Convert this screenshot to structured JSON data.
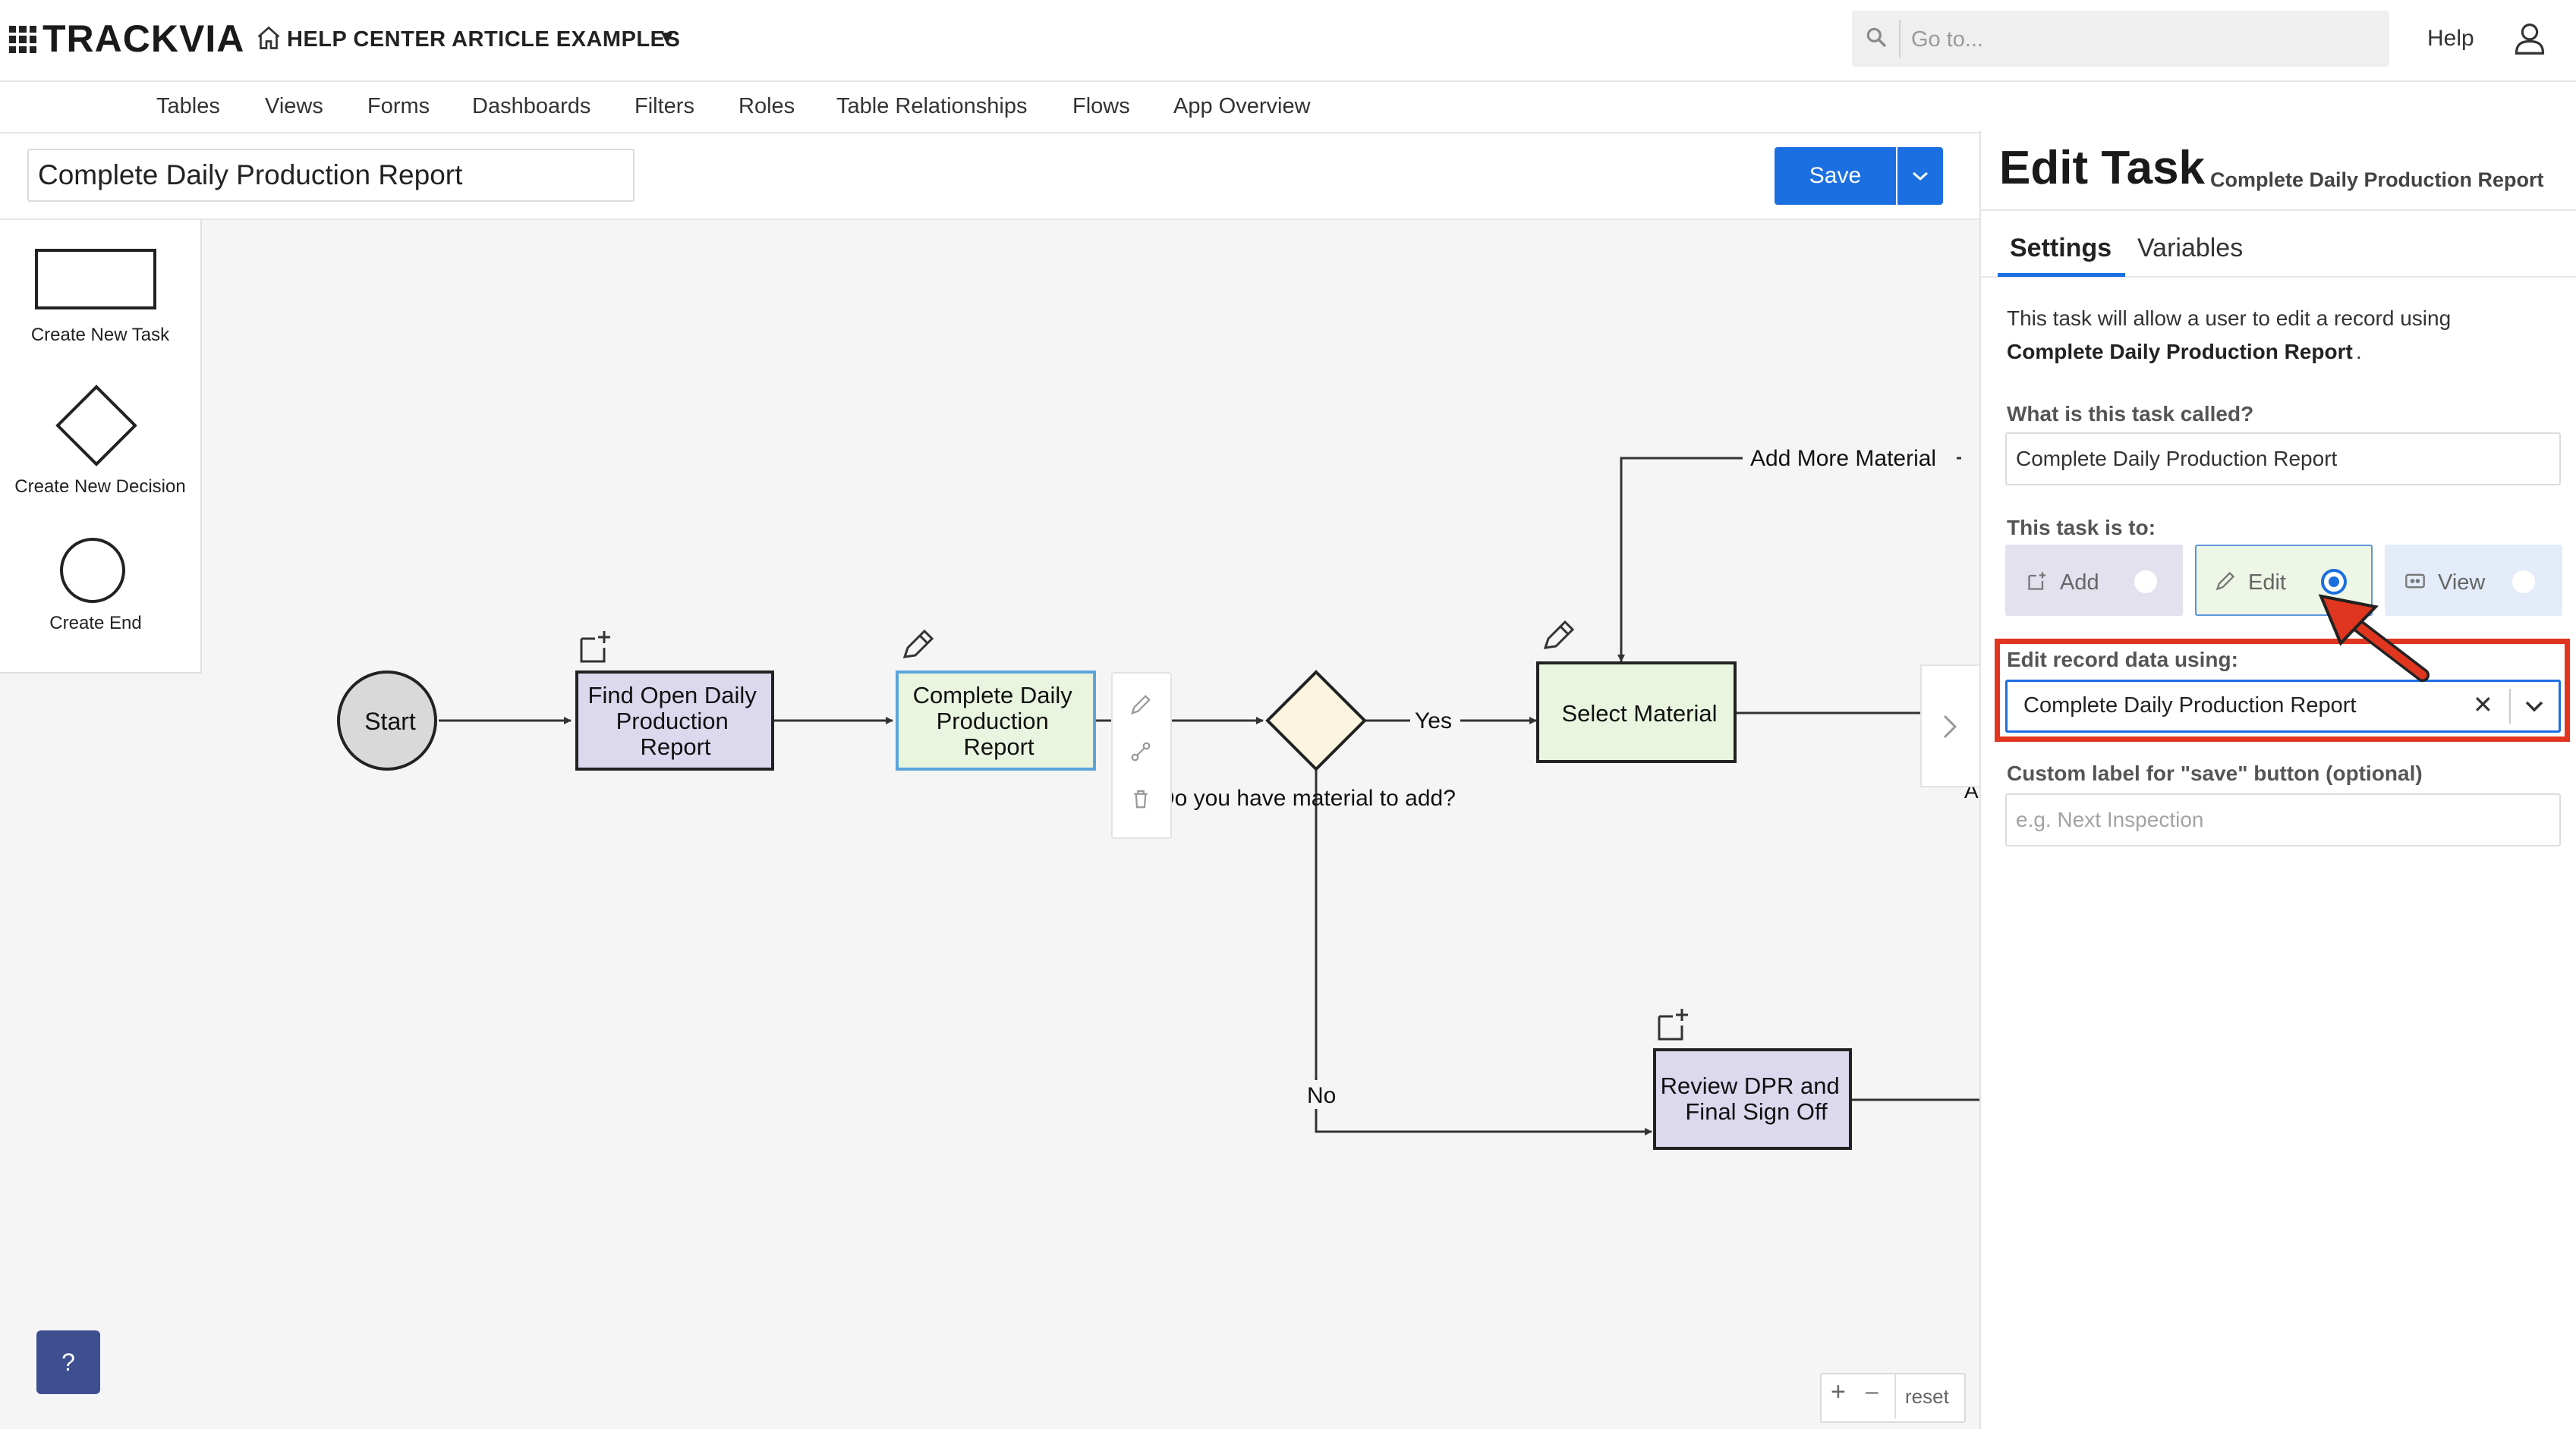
{
  "topbar": {
    "logo": "TRACKVIA",
    "app_name": "HELP CENTER ARTICLE EXAMPLES",
    "search_placeholder": "Go to...",
    "help_label": "Help"
  },
  "nav": {
    "items": [
      "Tables",
      "Views",
      "Forms",
      "Dashboards",
      "Filters",
      "Roles",
      "Table Relationships",
      "Flows",
      "App Overview"
    ]
  },
  "flow": {
    "name": "Complete Daily Production Report",
    "save_label": "Save"
  },
  "palette": {
    "items": [
      {
        "label": "Create New Task",
        "icon": "rectangle-icon"
      },
      {
        "label": "Create New Decision",
        "icon": "diamond-icon"
      },
      {
        "label": "Create End",
        "icon": "circle-icon"
      }
    ]
  },
  "diagram": {
    "nodes": {
      "start": "Start",
      "find": [
        "Find Open Daily",
        "Production",
        "Report"
      ],
      "complete": [
        "Complete Daily",
        "Production",
        "Report"
      ],
      "decision": "Do you have material to add?",
      "select": "Select Material",
      "review": [
        "Review DPR and",
        "Final Sign Off"
      ],
      "cut_label": "A"
    },
    "edges": {
      "yes": "Yes",
      "no": "No",
      "add_more": "Add More Material"
    },
    "colors": {
      "purple_task": "#dcd8ee",
      "green_task": "#eaf5e0",
      "selected_border": "#5aa5dc",
      "decision_fill": "#fbf5e0",
      "start_fill": "#d9d9d9"
    }
  },
  "controls": {
    "help_fab": "?",
    "zoom_in": "+",
    "zoom_out": "–",
    "reset": "reset"
  },
  "panel": {
    "title": "Edit Task",
    "subtitle": "Complete Daily Production Report",
    "tabs": {
      "settings": "Settings",
      "variables": "Variables"
    },
    "description_line1": "This task will allow a user to edit a record using",
    "description_table": "Complete Daily Production Report",
    "description_end": ".",
    "task_name_label": "What is this task called?",
    "task_name_value": "Complete Daily Production Report",
    "task_type_label": "This task is to:",
    "task_types": [
      {
        "label": "Add",
        "icon": "add-record-icon",
        "selected": false
      },
      {
        "label": "Edit",
        "icon": "pencil-icon",
        "selected": true
      },
      {
        "label": "View",
        "icon": "view-icon",
        "selected": false
      }
    ],
    "record_label": "Edit record data using:",
    "record_value": "Complete Daily Production Report",
    "save_label_label": "Custom label for \"save\" button (optional)",
    "save_label_placeholder": "e.g. Next Inspection",
    "accent_color": "#1c6fe0",
    "highlight_color": "#e0361f"
  }
}
